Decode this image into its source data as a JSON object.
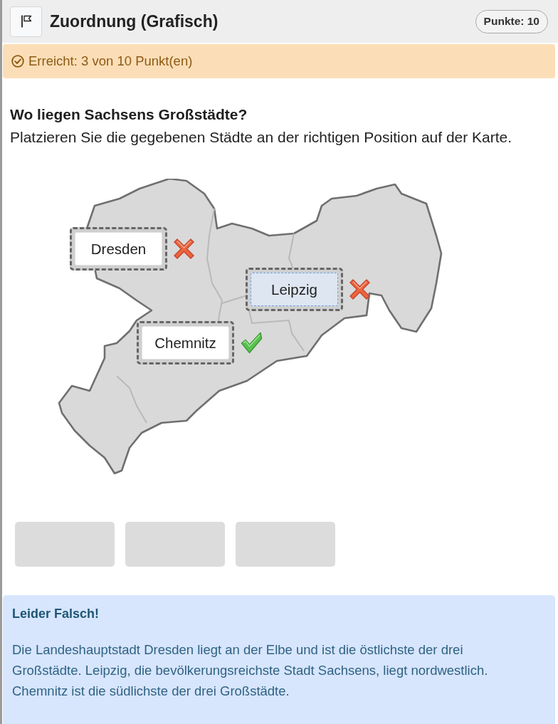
{
  "header": {
    "title": "Zuordnung (Grafisch)",
    "points_badge": "Punkte: 10"
  },
  "result_alert": {
    "text": "Erreicht: 3 von 10 Punkt(en)"
  },
  "question": {
    "title": "Wo liegen Sachsens Großstädte?",
    "instruction": "Platzieren Sie die gegebenen Städte an der richtigen Position auf der Karte."
  },
  "map": {
    "drop_zones": [
      {
        "label": "Dresden",
        "selected": false,
        "correct": false
      },
      {
        "label": "Leipzig",
        "selected": true,
        "correct": false
      },
      {
        "label": "Chemnitz",
        "selected": false,
        "correct": true
      }
    ]
  },
  "answer_slots": [
    {
      "filled": false
    },
    {
      "filled": false
    },
    {
      "filled": false
    }
  ],
  "feedback": {
    "title": "Leider Falsch!",
    "text": "Die Landeshauptstadt Dresden liegt an der Elbe und ist die östlichste der drei Großstädte. Leipzig, die bevölkerungsreichste Stadt Sachsens, liegt nordwestlich. Chemnitz ist die südlichste der drei Großstädte."
  }
}
